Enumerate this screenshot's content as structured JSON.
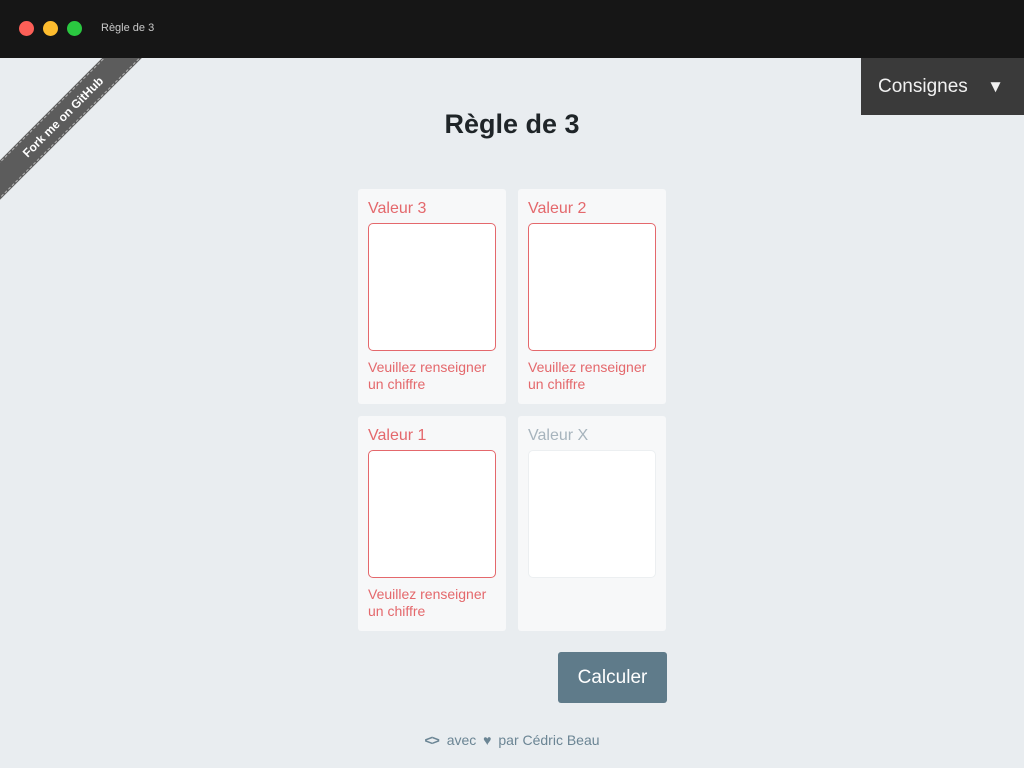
{
  "window": {
    "title": "Règle de 3"
  },
  "ribbon": {
    "label": "Fork me on GitHub"
  },
  "consignes": {
    "label": "Consignes",
    "arrow_icon": "triangle-down-icon"
  },
  "page": {
    "title": "Règle de 3"
  },
  "cards": [
    {
      "label": "Valeur 3",
      "value": "",
      "error": "Veuillez renseigner un chiffre"
    },
    {
      "label": "Valeur 2",
      "value": "",
      "error": "Veuillez renseigner un chiffre"
    },
    {
      "label": "Valeur 1",
      "value": "",
      "error": "Veuillez renseigner un chiffre"
    },
    {
      "label": "Valeur X",
      "value": "",
      "error": ""
    }
  ],
  "calculate_button": {
    "label": "Calculer"
  },
  "footer": {
    "code_icon": "code-brackets-icon",
    "text_avec": "avec",
    "heart_icon": "heart-icon",
    "text_par": "par Cédric Beau"
  },
  "colors": {
    "error": "#e4686c",
    "button": "#5f7b8a",
    "titlebar": "#161616"
  }
}
